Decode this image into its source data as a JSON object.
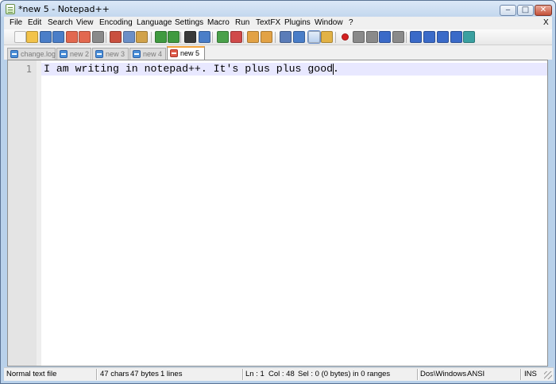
{
  "window": {
    "title": "*new  5 - Notepad++",
    "min_glyph": "‒",
    "max_glyph": "□",
    "close_glyph": "✕"
  },
  "menu": {
    "items": [
      "File",
      "Edit",
      "Search",
      "View",
      "Encoding",
      "Language",
      "Settings",
      "Macro",
      "Run",
      "TextFX",
      "Plugins",
      "Window",
      "?"
    ],
    "close_label": "X"
  },
  "toolbar": {
    "buttons": [
      {
        "name": "new-file-icon",
        "color": "#f7f7f7"
      },
      {
        "name": "open-file-icon",
        "color": "#f2c34a"
      },
      {
        "name": "save-icon",
        "color": "#4a7ec8"
      },
      {
        "name": "save-all-icon",
        "color": "#4a7ec8"
      },
      {
        "name": "close-file-icon",
        "color": "#e2684f"
      },
      {
        "name": "close-all-icon",
        "color": "#e2684f"
      },
      {
        "name": "print-icon",
        "color": "#8a8a8a"
      },
      {
        "name": "cut-icon",
        "color": "#c9503f"
      },
      {
        "name": "copy-icon",
        "color": "#6b8fc7"
      },
      {
        "name": "paste-icon",
        "color": "#d1a24a"
      },
      {
        "name": "undo-icon",
        "color": "#3f9a3f"
      },
      {
        "name": "redo-icon",
        "color": "#3f9a3f"
      },
      {
        "name": "find-icon",
        "color": "#3a3a3a"
      },
      {
        "name": "replace-icon",
        "color": "#4a7ec8"
      },
      {
        "name": "zoom-in-icon",
        "color": "#4aa14a"
      },
      {
        "name": "zoom-out-icon",
        "color": "#d04a4a"
      },
      {
        "name": "sync-vertical-icon",
        "color": "#e2a245"
      },
      {
        "name": "sync-horizontal-icon",
        "color": "#e2a245"
      },
      {
        "name": "word-wrap-icon",
        "color": "#5a7cb8"
      },
      {
        "name": "show-all-chars-icon",
        "color": "#4a7ec8"
      },
      {
        "name": "indent-guide-icon",
        "color": "#5a8ad8"
      },
      {
        "name": "user-language-icon",
        "color": "#e2b245"
      },
      {
        "name": "macro-record-icon",
        "color": "#d42020"
      },
      {
        "name": "macro-stop-icon",
        "color": "#8a8a8a"
      },
      {
        "name": "macro-play-icon",
        "color": "#8a8a8a"
      },
      {
        "name": "macro-play-multiple-icon",
        "color": "#3a6ac8"
      },
      {
        "name": "macro-save-icon",
        "color": "#8a8a8a"
      },
      {
        "name": "textfx-sort-icon",
        "color": "#3a6ac8"
      },
      {
        "name": "textfx-up-icon",
        "color": "#3a6ac8"
      },
      {
        "name": "textfx-down-icon",
        "color": "#3a6ac8"
      },
      {
        "name": "textfx-sum-icon",
        "color": "#3a6ac8"
      },
      {
        "name": "spell-check-icon",
        "color": "#3aa0a0"
      }
    ]
  },
  "tabs": [
    {
      "label": "change.log",
      "active": false
    },
    {
      "label": "new  2",
      "active": false
    },
    {
      "label": "new  3",
      "active": false
    },
    {
      "label": "new  4",
      "active": false
    },
    {
      "label": "new  5",
      "active": true
    }
  ],
  "editor": {
    "lines": [
      {
        "number": "1",
        "text": "I am writing in notepad++. It's plus plus good."
      }
    ]
  },
  "status": {
    "file_type": "Normal text file",
    "chars": "47 chars",
    "bytes": "47 bytes",
    "lines": "1 lines",
    "ln": "Ln : 1",
    "col": "Col : 48",
    "sel": "Sel : 0 (0 bytes) in 0 ranges",
    "eol": "Dos\\Windows",
    "encoding": "ANSI",
    "mode": "INS"
  }
}
